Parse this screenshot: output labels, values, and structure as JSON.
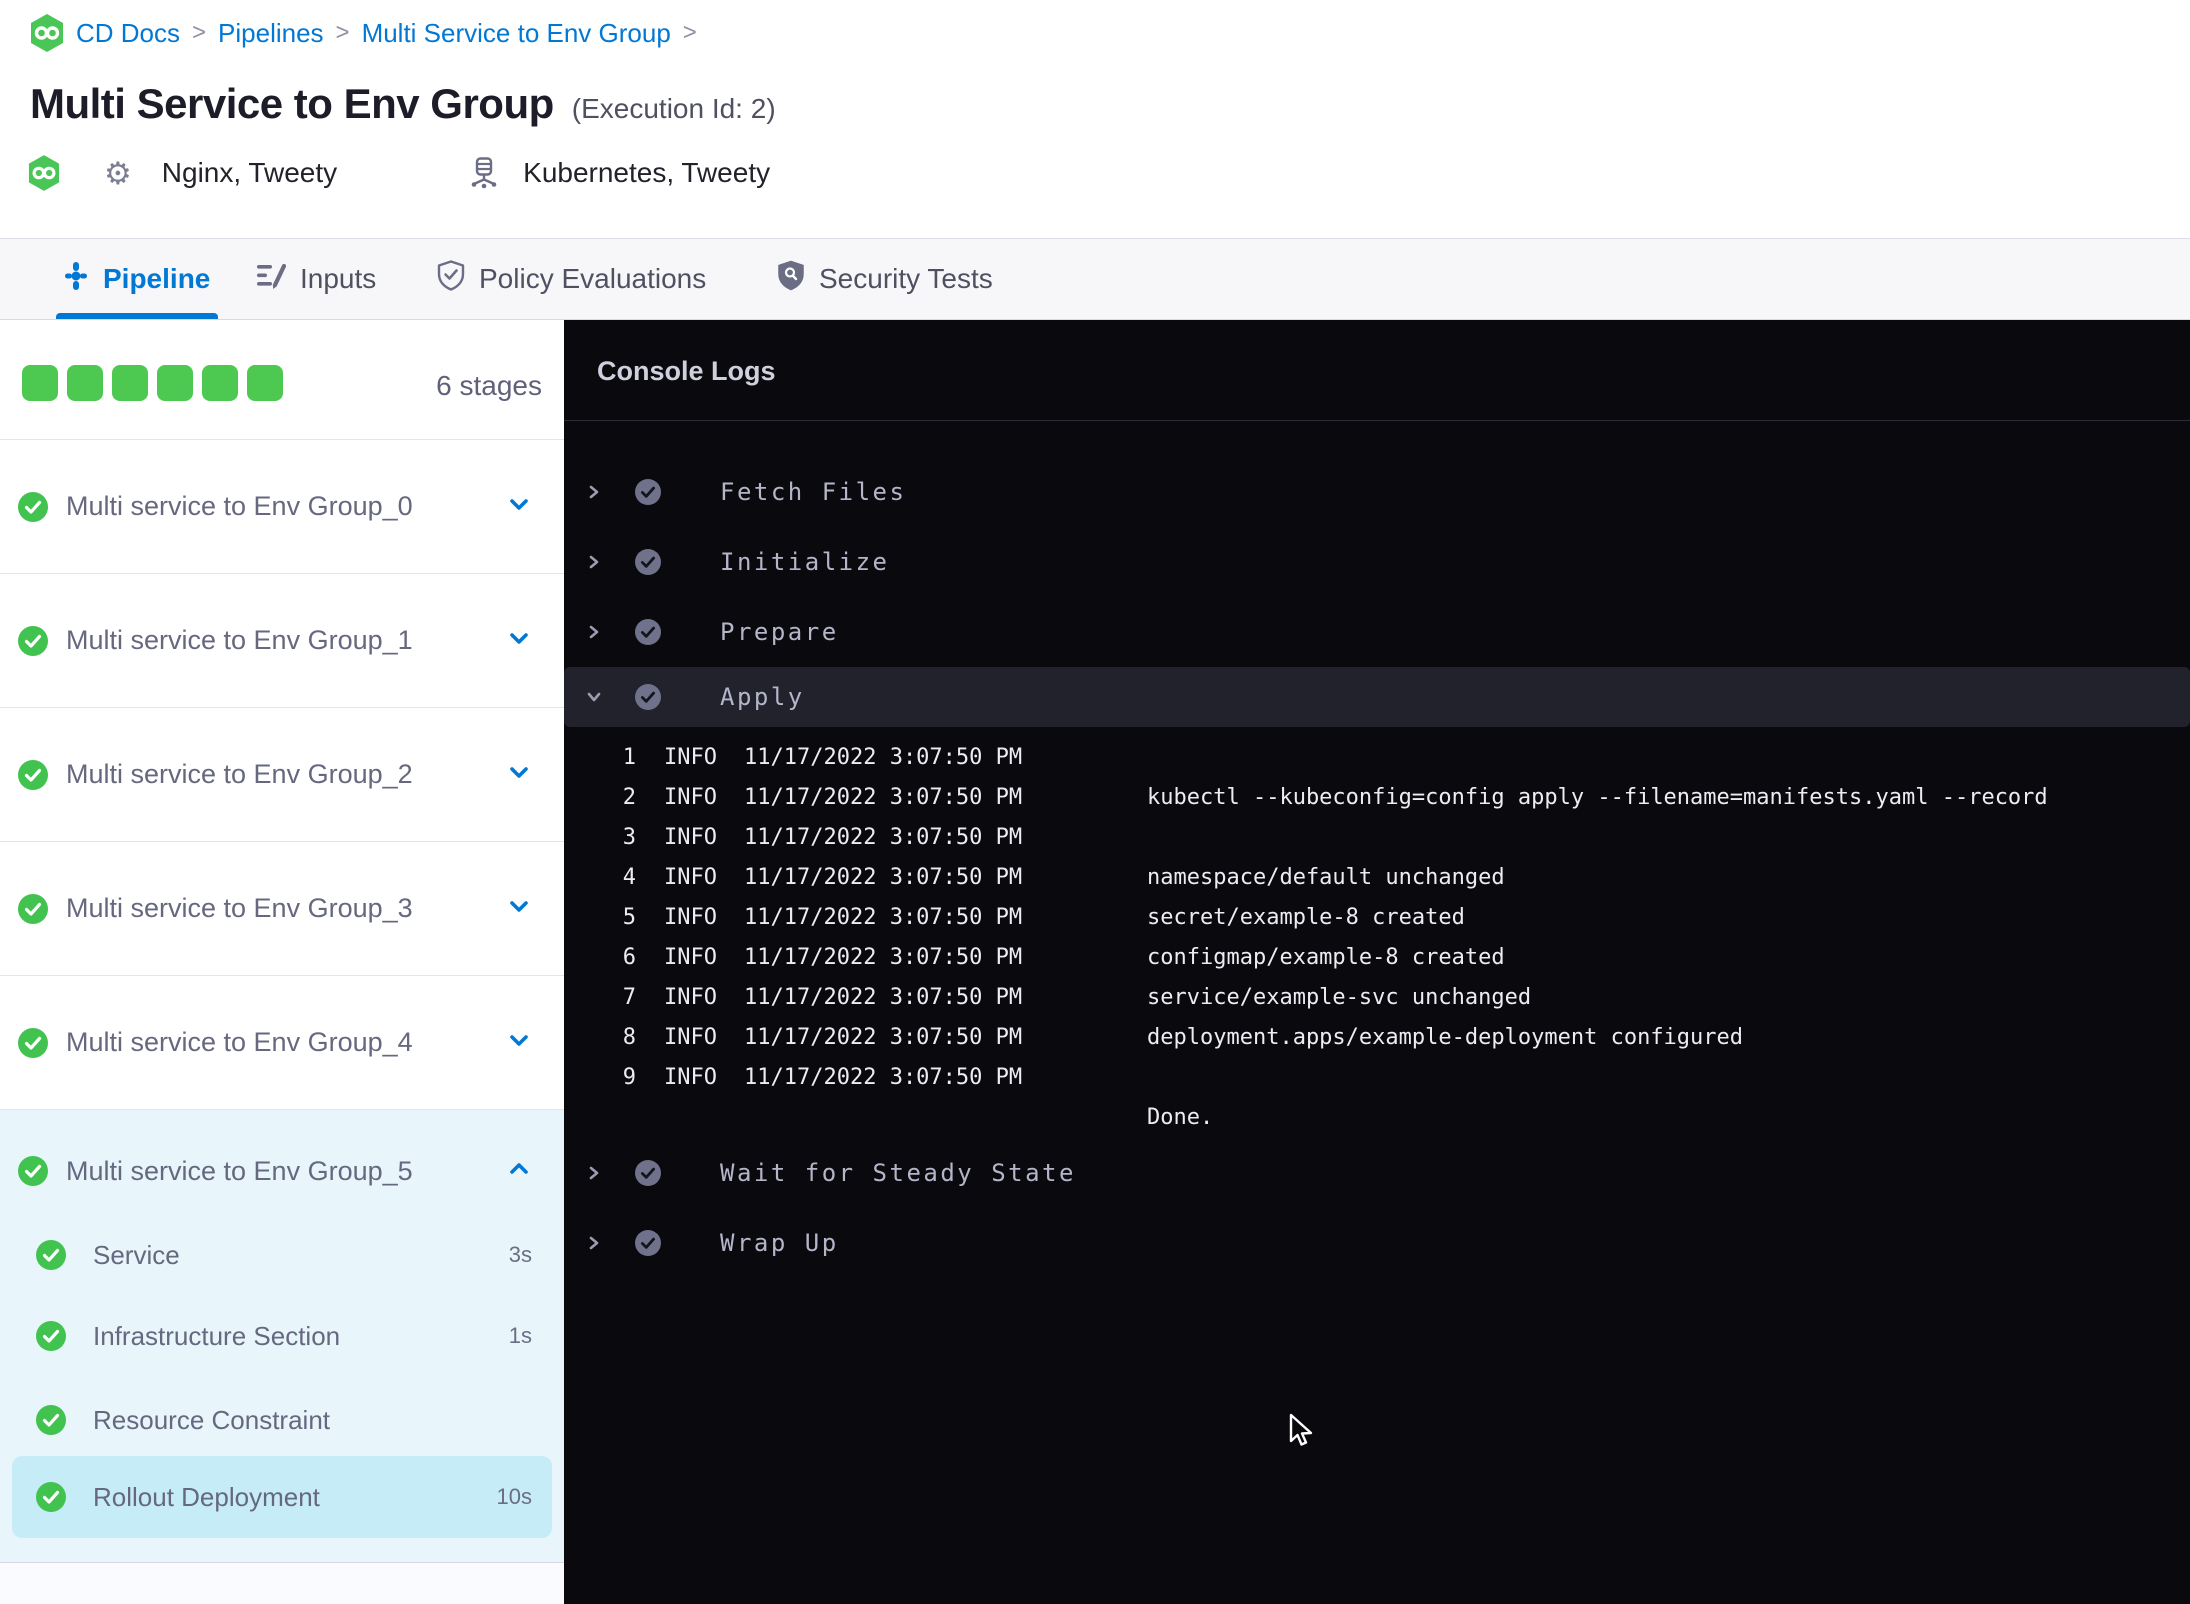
{
  "breadcrumb": {
    "items": [
      "CD Docs",
      "Pipelines",
      "Multi Service to Env Group"
    ],
    "separator": ">"
  },
  "header": {
    "title": "Multi Service to Env Group",
    "execution_id_label": "(Execution Id: 2)",
    "services": [
      {
        "icon": "gear-icon",
        "label": "Nginx, Tweety"
      },
      {
        "icon": "kubernetes-icon",
        "label": "Kubernetes, Tweety"
      }
    ]
  },
  "tabs": [
    {
      "label": "Pipeline",
      "active": true
    },
    {
      "label": "Inputs",
      "active": false
    },
    {
      "label": "Policy Evaluations",
      "active": false
    },
    {
      "label": "Security Tests",
      "active": false
    }
  ],
  "sidebar": {
    "stage_count_label": "6 stages",
    "square_count": 6,
    "stages": [
      {
        "name": "Multi service to Env Group_0",
        "status": "success"
      },
      {
        "name": "Multi service to Env Group_1",
        "status": "success"
      },
      {
        "name": "Multi service to Env Group_2",
        "status": "success"
      },
      {
        "name": "Multi service to Env Group_3",
        "status": "success"
      },
      {
        "name": "Multi service to Env Group_4",
        "status": "success"
      }
    ],
    "expanded_stage": {
      "name": "Multi service to Env Group_5",
      "status": "success",
      "steps": [
        {
          "name": "Service",
          "duration": "3s",
          "selected": false
        },
        {
          "name": "Infrastructure Section",
          "duration": "1s",
          "selected": false
        },
        {
          "name": "Resource Constraint",
          "duration": "",
          "selected": false
        },
        {
          "name": "Rollout Deployment",
          "duration": "10s",
          "selected": true
        }
      ]
    }
  },
  "console": {
    "title": "Console Logs",
    "sections": [
      {
        "name": "Fetch Files",
        "expanded": false
      },
      {
        "name": "Initialize",
        "expanded": false
      },
      {
        "name": "Prepare",
        "expanded": false
      },
      {
        "name": "Apply",
        "expanded": true
      },
      {
        "name": "Wait for Steady State",
        "expanded": false
      },
      {
        "name": "Wrap Up",
        "expanded": false
      }
    ],
    "logs": [
      {
        "n": "1",
        "level": "INFO",
        "ts": "11/17/2022 3:07:50 PM",
        "msg": ""
      },
      {
        "n": "2",
        "level": "INFO",
        "ts": "11/17/2022 3:07:50 PM",
        "msg": "kubectl --kubeconfig=config apply --filename=manifests.yaml --record"
      },
      {
        "n": "3",
        "level": "INFO",
        "ts": "11/17/2022 3:07:50 PM",
        "msg": ""
      },
      {
        "n": "4",
        "level": "INFO",
        "ts": "11/17/2022 3:07:50 PM",
        "msg": "namespace/default unchanged"
      },
      {
        "n": "5",
        "level": "INFO",
        "ts": "11/17/2022 3:07:50 PM",
        "msg": "secret/example-8 created"
      },
      {
        "n": "6",
        "level": "INFO",
        "ts": "11/17/2022 3:07:50 PM",
        "msg": "configmap/example-8 created"
      },
      {
        "n": "7",
        "level": "INFO",
        "ts": "11/17/2022 3:07:50 PM",
        "msg": "service/example-svc unchanged"
      },
      {
        "n": "8",
        "level": "INFO",
        "ts": "11/17/2022 3:07:50 PM",
        "msg": "deployment.apps/example-deployment configured"
      },
      {
        "n": "9",
        "level": "INFO",
        "ts": "11/17/2022 3:07:50 PM",
        "msg": ""
      },
      {
        "n": "",
        "level": "",
        "ts": "",
        "msg": "Done."
      }
    ]
  },
  "colors": {
    "accent_blue": "#0278d5",
    "success_green": "#4dc952",
    "selected_step_bg": "#c6ecf8",
    "expanded_stage_bg": "#e8f6fc",
    "console_bg": "#0a0a0e",
    "console_selected_row": "#21222c"
  }
}
